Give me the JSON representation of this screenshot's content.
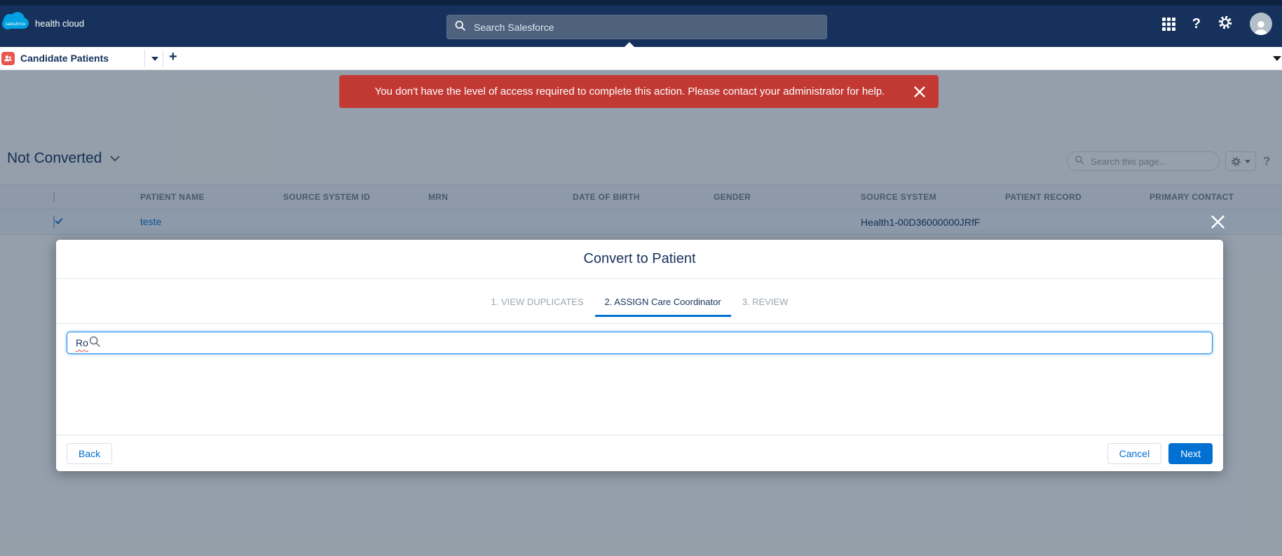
{
  "colors": {
    "navbar": "#16325c",
    "brand_cloud": "#00a1e0",
    "accent": "#0070d2",
    "error": "#c23934",
    "object_icon": "#e8574f"
  },
  "glyphs": {
    "help": "?",
    "plus": "+"
  },
  "global_nav": {
    "brand": "health cloud",
    "search_placeholder": "Search Salesforce"
  },
  "tab_bar": {
    "active_tab": "Candidate Patients"
  },
  "toast": {
    "message": "You don't have the level of access required to complete this action. Please contact your administrator for help."
  },
  "list_view": {
    "title": "Not Converted",
    "search_placeholder": "Search this page...",
    "columns": [
      "PATIENT NAME",
      "SOURCE SYSTEM ID",
      "MRN",
      "DATE OF BIRTH",
      "GENDER",
      "SOURCE SYSTEM",
      "PATIENT RECORD",
      "PRIMARY CONTACT"
    ],
    "rows": [
      {
        "patient_name": "teste",
        "source_system": "Health1-00D36000000JRfF",
        "selected": true
      }
    ]
  },
  "modal": {
    "title": "Convert to Patient",
    "steps": [
      {
        "label": "1. VIEW DUPLICATES",
        "active": false
      },
      {
        "label": "2. ASSIGN Care Coordinator",
        "active": true
      },
      {
        "label": "3. REVIEW",
        "active": false
      }
    ],
    "search_value": "Ro",
    "back_label": "Back",
    "cancel_label": "Cancel",
    "next_label": "Next"
  }
}
